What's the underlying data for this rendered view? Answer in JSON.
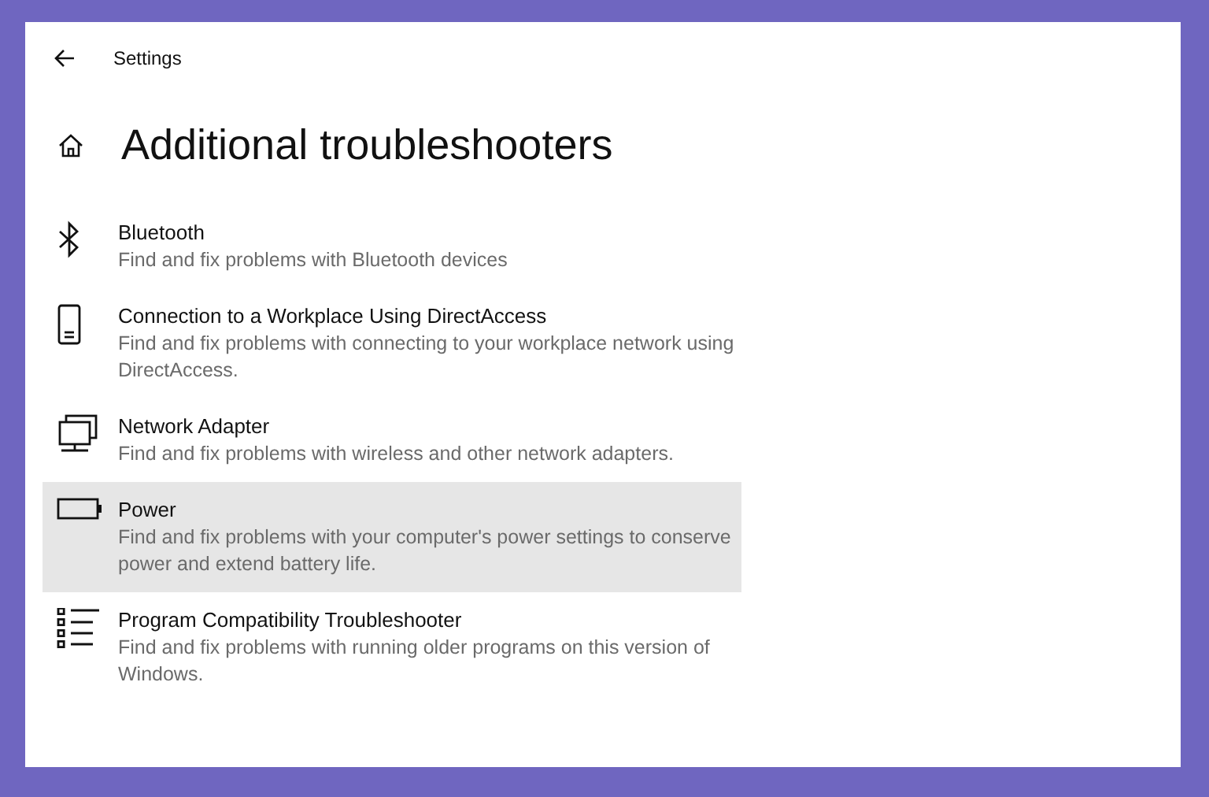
{
  "window": {
    "title": "Settings"
  },
  "page": {
    "title": "Additional troubleshooters"
  },
  "items": [
    {
      "kind": "bluetooth",
      "title": "Bluetooth",
      "description": "Find and fix problems with Bluetooth devices",
      "selected": false
    },
    {
      "kind": "phone",
      "title": "Connection to a Workplace Using DirectAccess",
      "description": "Find and fix problems with connecting to your workplace network using DirectAccess.",
      "selected": false
    },
    {
      "kind": "network",
      "title": "Network Adapter",
      "description": "Find and fix problems with wireless and other network adapters.",
      "selected": false
    },
    {
      "kind": "battery",
      "title": "Power",
      "description": "Find and fix problems with your computer's power settings to conserve power and extend battery life.",
      "selected": true
    },
    {
      "kind": "list",
      "title": "Program Compatibility Troubleshooter",
      "description": "Find and fix problems with running older programs on this version of Windows.",
      "selected": false
    }
  ]
}
